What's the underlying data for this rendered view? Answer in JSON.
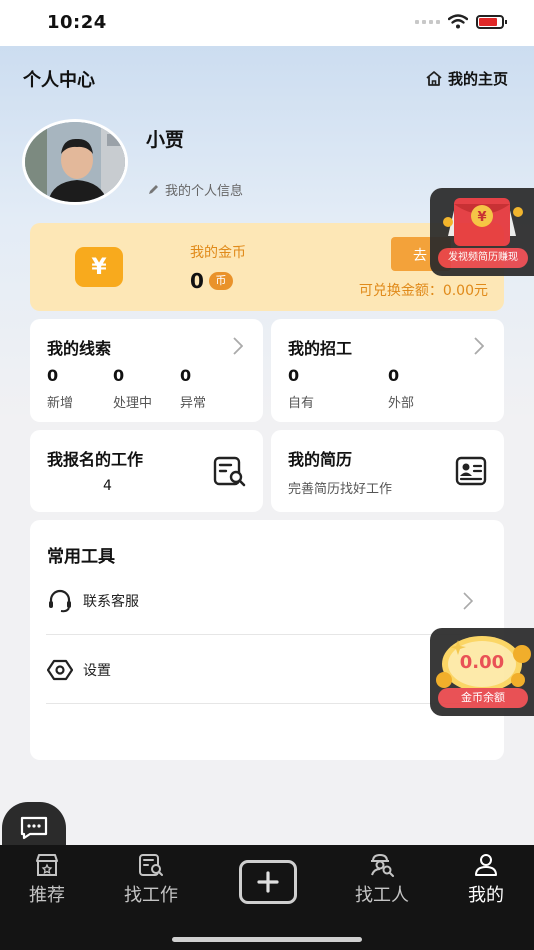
{
  "status_bar": {
    "time": "10:24"
  },
  "header": {
    "title": "个人中心",
    "home_link": "我的主页"
  },
  "profile": {
    "name": "小贾",
    "info_link": "我的个人信息"
  },
  "coins": {
    "label": "我的金币",
    "value": "0",
    "unit": "币",
    "go_button": "去",
    "exchange_text": "可兑换金额：0.00元"
  },
  "leads": {
    "title": "我的线索",
    "stats": [
      {
        "value": "0",
        "label": "新增"
      },
      {
        "value": "0",
        "label": "处理中"
      },
      {
        "value": "0",
        "label": "异常"
      }
    ]
  },
  "recruit": {
    "title": "我的招工",
    "stats": [
      {
        "value": "0",
        "label": "自有"
      },
      {
        "value": "0",
        "label": "外部"
      }
    ]
  },
  "applied_jobs": {
    "title": "我报名的工作",
    "count": "4"
  },
  "resume": {
    "title": "我的简历",
    "subtitle": "完善简历找好工作"
  },
  "tools": {
    "title": "常用工具",
    "items": [
      {
        "label": "联系客服",
        "icon": "headset-icon"
      },
      {
        "label": "设置",
        "icon": "settings-icon"
      }
    ]
  },
  "floating": {
    "red_packet_tag": "发视频简历赚现",
    "coin_balance_value": "0.00",
    "coin_balance_tag": "金币余额"
  },
  "tab_bar": {
    "items": [
      {
        "label": "推荐",
        "icon": "shop-icon"
      },
      {
        "label": "找工作",
        "icon": "job-search-icon"
      },
      {
        "label": "",
        "icon": "plus-icon"
      },
      {
        "label": "找工人",
        "icon": "worker-search-icon"
      },
      {
        "label": "我的",
        "icon": "user-icon"
      }
    ],
    "active": "我的"
  },
  "colors": {
    "accent_orange": "#f3a23a",
    "coin_card_bg": "#fde7b6",
    "tag_red": "#e8454a",
    "tab_bar_bg": "#141414"
  }
}
